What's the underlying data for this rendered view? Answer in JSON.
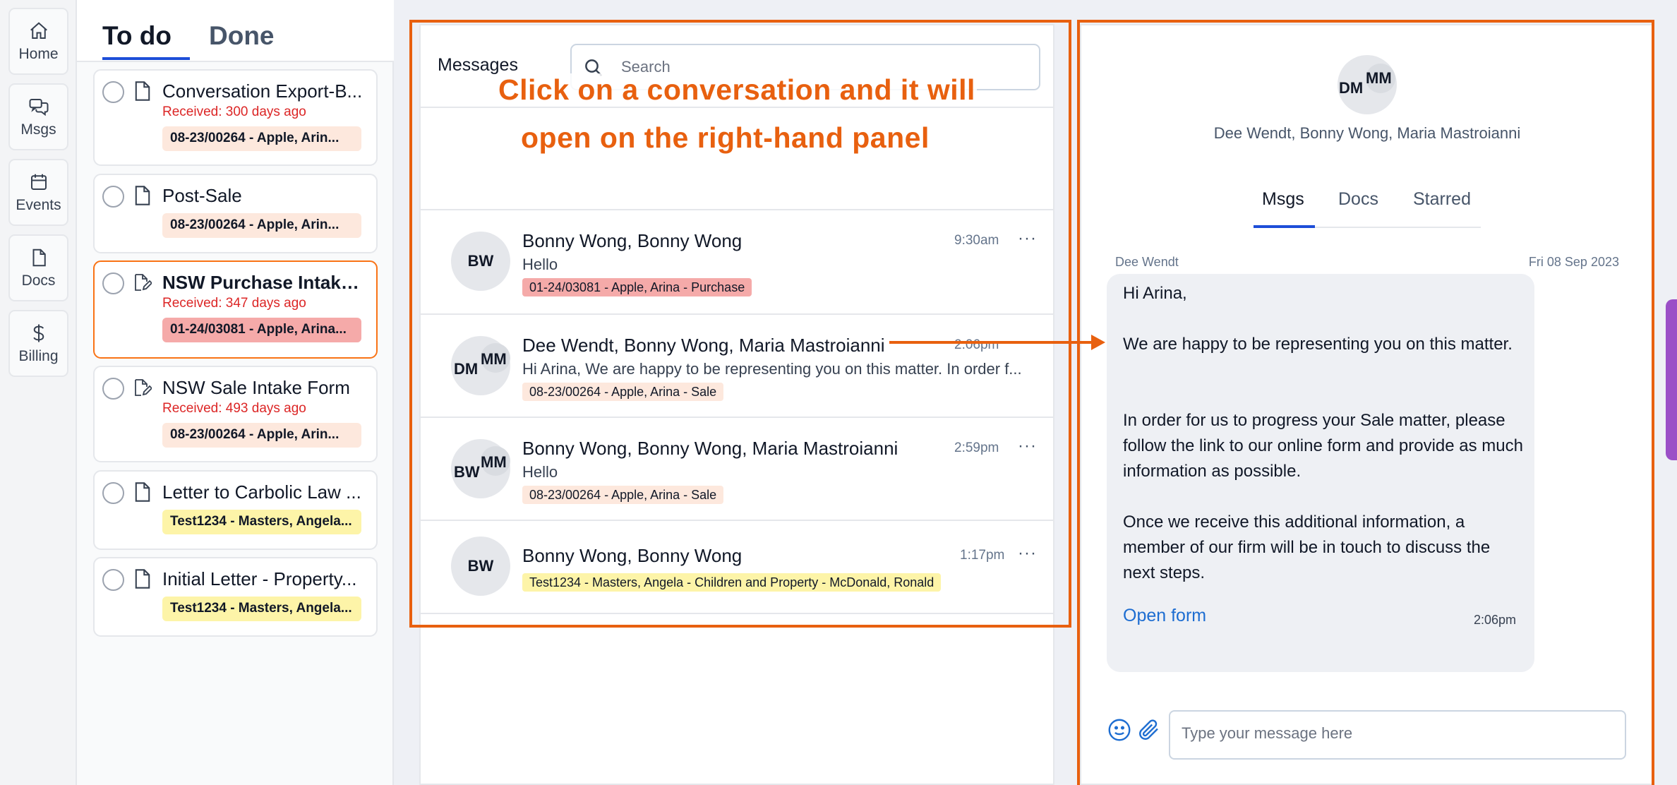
{
  "nav": {
    "items": [
      {
        "label": "Home",
        "icon": "home-icon"
      },
      {
        "label": "Msgs",
        "icon": "chat-icon"
      },
      {
        "label": "Events",
        "icon": "calendar-icon"
      },
      {
        "label": "Docs",
        "icon": "document-icon"
      },
      {
        "label": "Billing",
        "icon": "dollar-icon"
      }
    ]
  },
  "todo": {
    "tab_todo": "To do",
    "tab_done": "Done",
    "cards": [
      {
        "title": "Conversation Export-B...",
        "received": "Received: 300 days ago",
        "tag": "08-23/00264 - Apple, Arin...",
        "icon": "document-icon"
      },
      {
        "title": "Post-Sale",
        "received": "",
        "tag": "08-23/00264 - Apple, Arin...",
        "icon": "document-icon"
      },
      {
        "title": "NSW Purchase Intake ...",
        "received": "Received: 347 days ago",
        "tag": "01-24/03081 - Apple, Arina...",
        "icon": "edit-document-icon"
      },
      {
        "title": "NSW Sale Intake Form",
        "received": "Received: 493 days ago",
        "tag": "08-23/00264 - Apple, Arin...",
        "icon": "edit-document-icon"
      },
      {
        "title": "Letter to Carbolic Law ...",
        "received": "",
        "tag": "Test1234 - Masters, Angela...",
        "icon": "document-icon"
      },
      {
        "title": "Initial Letter - Property...",
        "received": "",
        "tag": "Test1234 - Masters, Angela...",
        "icon": "document-icon"
      }
    ]
  },
  "messages": {
    "title": "Messages",
    "search_placeholder": "Search",
    "conversations": [
      {
        "avatar": "BW",
        "avatar2": "",
        "name": "Bonny Wong, Bonny Wong",
        "preview": "Hello",
        "time": "9:30am",
        "tag": "01-24/03081 - Apple, Arina - Purchase"
      },
      {
        "avatar": "DM",
        "avatar2": "MM",
        "name": "Dee Wendt, Bonny Wong, Maria Mastroianni",
        "preview": "Hi Arina, We are happy to be representing you on this matter. In order f...",
        "time": "2:06pm",
        "tag": "08-23/00264 - Apple, Arina - Sale"
      },
      {
        "avatar": "BW",
        "avatar2": "MM",
        "name": "Bonny Wong, Bonny Wong, Maria Mastroianni",
        "preview": "Hello",
        "time": "2:59pm",
        "tag": "08-23/00264 - Apple, Arina - Sale"
      },
      {
        "avatar": "BW",
        "avatar2": "",
        "name": "Bonny Wong, Bonny Wong",
        "preview": "",
        "time": "1:17pm",
        "tag": "Test1234 - Masters, Angela - Children and Property - McDonald, Ronald"
      }
    ],
    "more_label": "···"
  },
  "annotation": {
    "line1": "Click on a conversation and it will",
    "line2": "open on the right-hand panel",
    "color": "#e8600f"
  },
  "detail": {
    "avatar": "DM",
    "avatar2": "MM",
    "participants": "Dee Wendt, Bonny Wong, Maria Mastroianni",
    "tabs": [
      "Msgs",
      "Docs",
      "Starred"
    ],
    "message": {
      "sender": "Dee Wendt",
      "date": "Fri 08 Sep 2023",
      "greeting": "Hi Arina,",
      "para1": "We are happy to be representing you on this matter.",
      "para2": "In order for us to progress your Sale matter, please follow the link to our online form and provide as much information as possible.",
      "para3": "Once we receive this additional information, a member of our firm will be in touch to discuss the next steps.",
      "link": "Open form",
      "time": "2:06pm"
    },
    "composer_placeholder": "Type your message here"
  },
  "colors": {
    "accent": "#1d4ed8",
    "received": "#dc2626",
    "tag_sale": "#fde8dd",
    "tag_purchase": "#f5aaa9",
    "tag_test": "#fdf4a8"
  }
}
